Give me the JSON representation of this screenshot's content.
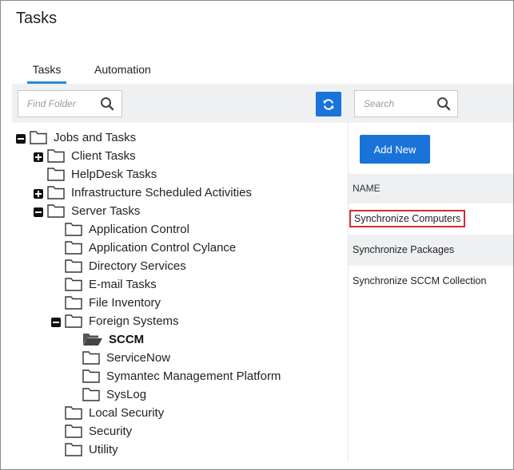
{
  "page": {
    "title": "Tasks"
  },
  "tabs": [
    {
      "label": "Tasks",
      "active": true
    },
    {
      "label": "Automation",
      "active": false
    }
  ],
  "folder_search": {
    "placeholder": "Find Folder"
  },
  "task_search": {
    "placeholder": "Search"
  },
  "tree": {
    "root": "Jobs and Tasks",
    "client_tasks": "Client Tasks",
    "helpdesk_tasks": "HelpDesk Tasks",
    "infrastructure": "Infrastructure Scheduled Activities",
    "server_tasks": "Server Tasks",
    "application_control": "Application Control",
    "application_control_cylance": "Application Control Cylance",
    "directory_services": "Directory Services",
    "email_tasks": "E-mail Tasks",
    "file_inventory": "File Inventory",
    "foreign_systems": "Foreign Systems",
    "sccm": "SCCM",
    "servicenow": "ServiceNow",
    "symantec": "Symantec Management Platform",
    "syslog": "SysLog",
    "local_security": "Local Security",
    "security": "Security",
    "utility": "Utility"
  },
  "add_button": {
    "label": "Add New"
  },
  "task_list": {
    "header": "NAME",
    "rows": [
      "Synchronize Computers",
      "Synchronize Packages",
      "Synchronize SCCM Collection"
    ]
  },
  "colors": {
    "accent": "#1a73d9",
    "selection_outline": "#d52b32",
    "toolbar_bg": "#eef0f2"
  }
}
